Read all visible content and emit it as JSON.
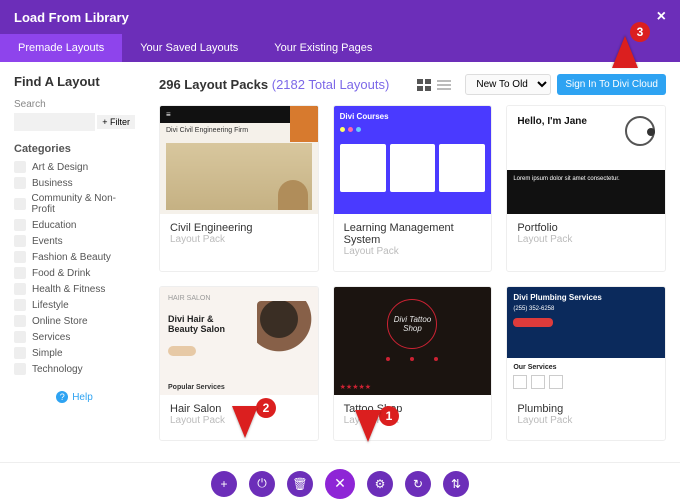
{
  "topbar": {
    "title": "Load From Library",
    "close": "×"
  },
  "tabs": [
    {
      "label": "Premade Layouts",
      "active": true
    },
    {
      "label": "Your Saved Layouts",
      "active": false
    },
    {
      "label": "Your Existing Pages",
      "active": false
    }
  ],
  "sidebar": {
    "heading": "Find A Layout",
    "search_label": "Search",
    "filter_label": "+ Filter",
    "categories_label": "Categories",
    "categories": [
      "Art & Design",
      "Business",
      "Community & Non-Profit",
      "Education",
      "Events",
      "Fashion & Beauty",
      "Food & Drink",
      "Health & Fitness",
      "Lifestyle",
      "Online Store",
      "Services",
      "Simple",
      "Technology"
    ],
    "help_label": "Help"
  },
  "content": {
    "count_primary": "296 Layout Packs",
    "count_secondary": "(2182 Total Layouts)",
    "sort": {
      "selected": "New To Old"
    },
    "signin_label": "Sign In To Divi Cloud",
    "cards": [
      {
        "title": "Civil Engineering",
        "sub": "Layout Pack",
        "thumb": {
          "brand": "Divi Civil Engineering Firm"
        }
      },
      {
        "title": "Learning Management System",
        "sub": "Layout Pack",
        "thumb": {
          "brand": "Divi Courses"
        }
      },
      {
        "title": "Portfolio",
        "sub": "Layout Pack",
        "thumb": {
          "hello": "Hello, I'm Jane"
        }
      },
      {
        "title": "Hair Salon",
        "sub": "Layout Pack",
        "thumb": {
          "brand": "Divi Hair & Beauty Salon",
          "footer": "Popular Services"
        }
      },
      {
        "title": "Tattoo Shop",
        "sub": "Layout Pack",
        "thumb": {
          "brand": "Divi Tattoo Shop"
        }
      },
      {
        "title": "Plumbing",
        "sub": "Layout Pack",
        "thumb": {
          "brand": "Divi Plumbing Services",
          "phone": "(255) 352-6258",
          "svc": "Our Services"
        }
      }
    ]
  },
  "bottom_icons": [
    "+",
    "⏻",
    "🗑",
    "✕",
    "⚙",
    "↻",
    "⇅"
  ],
  "callouts": {
    "c1": "1",
    "c2": "2",
    "c3": "3"
  }
}
